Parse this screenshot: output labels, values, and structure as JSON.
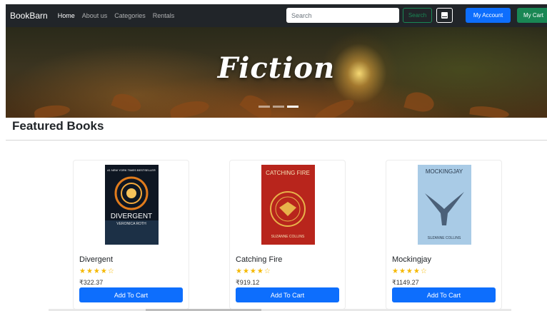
{
  "navbar": {
    "brand": "BookBarn",
    "links": [
      "Home",
      "About us",
      "Categories",
      "Rentals"
    ],
    "search_placeholder": "Search",
    "search_button": "Search",
    "account_button": "My Account",
    "cart_button": "My Cart"
  },
  "hero": {
    "title": "Fiction",
    "slide_count": 3,
    "active_slide": 3
  },
  "section": {
    "title": "Featured Books"
  },
  "books": [
    {
      "title": "Divergent",
      "rating": 4,
      "max_rating": 5,
      "stars": "★★★★☆",
      "price": "₹322.37",
      "button": "Add To Cart",
      "cover": {
        "top_text": "#1 NEW YORK TIMES BESTSELLER",
        "title_text": "DIVERGENT",
        "author_text": "VERONICA ROTH",
        "color": "#0e1622"
      }
    },
    {
      "title": "Catching Fire",
      "rating": 4,
      "max_rating": 5,
      "stars": "★★★★☆",
      "price": "₹919.12",
      "button": "Add To Cart",
      "cover": {
        "title_text": "CATCHING FIRE",
        "author_text": "SUZANNE COLLINS",
        "color": "#b8251c"
      }
    },
    {
      "title": "Mockingjay",
      "rating": 4,
      "max_rating": 5,
      "stars": "★★★★☆",
      "price": "₹1149.27",
      "button": "Add To Cart",
      "cover": {
        "title_text": "MOCKINGJAY",
        "author_text": "SUZANNE COLLINS",
        "color": "#a9cbe6"
      }
    }
  ],
  "colors": {
    "navbar_bg": "#212529",
    "primary": "#0d6efd",
    "success": "#198754",
    "star": "#f5b800"
  }
}
